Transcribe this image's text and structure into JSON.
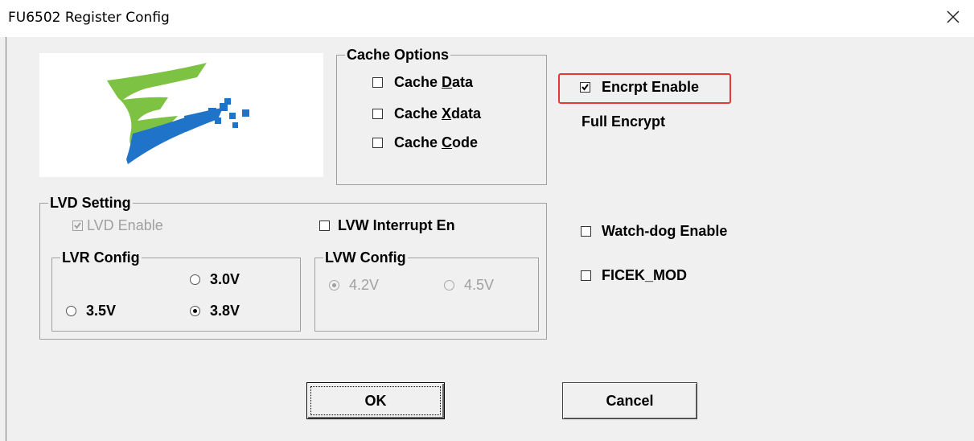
{
  "window": {
    "title": "FU6502 Register Config",
    "close_icon": "close-icon"
  },
  "logo": {
    "icon": "fortior-logo",
    "colors": {
      "green": "#7dc242",
      "blue": "#1f73c9"
    }
  },
  "cache_options": {
    "title": "Cache Options",
    "items": [
      {
        "label_pre": "Cache ",
        "label_ul": "D",
        "label_post": "ata",
        "checked": false
      },
      {
        "label_pre": "Cache ",
        "label_ul": "X",
        "label_post": "data",
        "checked": false
      },
      {
        "label_pre": "Cache ",
        "label_ul": "C",
        "label_post": "ode",
        "checked": false
      }
    ]
  },
  "encrypt": {
    "label": "Encrpt Enable",
    "checked": true,
    "mode_text": "Full Encrypt",
    "highlight_color": "#e53935"
  },
  "lvd": {
    "title": "LVD Setting",
    "enable_label": "LVD Enable",
    "enable_checked": true,
    "enable_disabled": true,
    "lvw_interrupt_label": "LVW Interrupt En",
    "lvw_interrupt_checked": false,
    "lvr": {
      "title": "LVR Config",
      "options": [
        "3.0V",
        "3.5V",
        "3.8V"
      ],
      "selected": "3.8V"
    },
    "lvw": {
      "title": "LVW Config",
      "options": [
        "4.2V",
        "4.5V"
      ],
      "selected": "4.2V",
      "disabled": true
    }
  },
  "watchdog": {
    "label": "Watch-dog Enable",
    "checked": false
  },
  "ficek": {
    "label": "FICEK_MOD",
    "checked": false
  },
  "buttons": {
    "ok": "OK",
    "cancel": "Cancel"
  }
}
